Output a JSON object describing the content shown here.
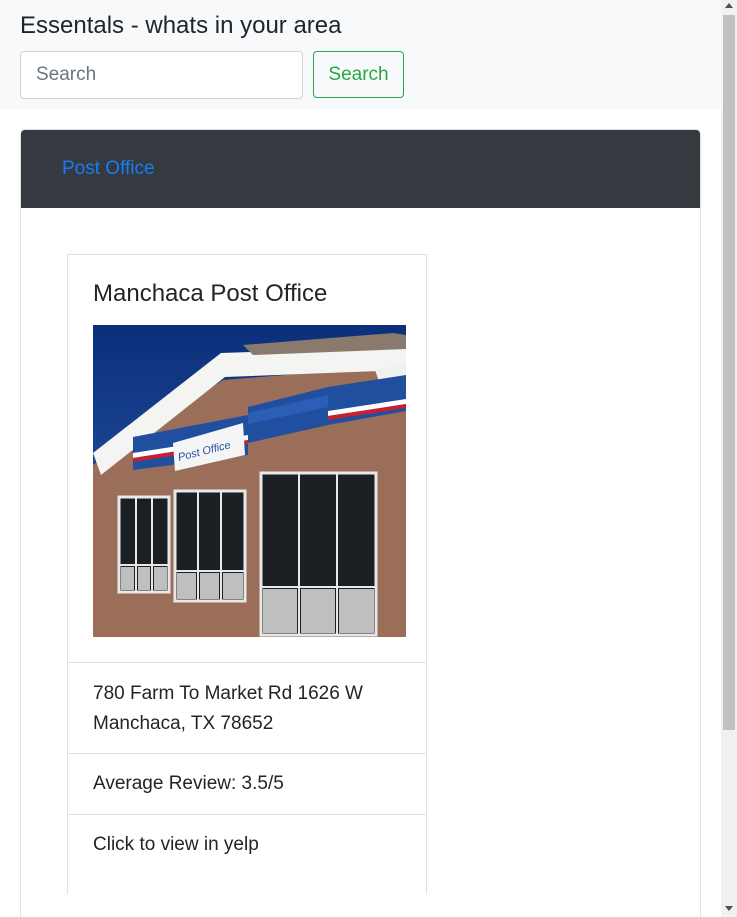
{
  "navbar": {
    "brand": "Essentals - whats in your area",
    "search_placeholder": "Search",
    "search_button": "Search"
  },
  "category": {
    "tab_label": "Post Office"
  },
  "place": {
    "name": "Manchaca Post Office",
    "address_line1": "780 Farm To Market Rd 1626 W",
    "address_line2": "Manchaca, TX 78652",
    "review": "Average Review: 3.5/5",
    "yelp_link": "Click to view in yelp",
    "sign_text": "Post Office"
  },
  "colors": {
    "navbar_bg": "#f8f9fa",
    "header_bg": "#343a40",
    "link": "#1a7cf5",
    "success": "#28a745"
  }
}
